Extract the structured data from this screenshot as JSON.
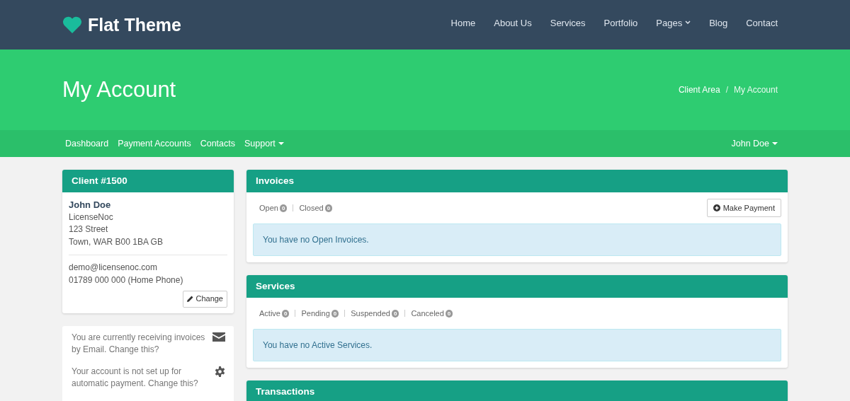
{
  "brand": {
    "name": "Flat Theme"
  },
  "nav": [
    {
      "label": "Home",
      "dropdown": false
    },
    {
      "label": "About Us",
      "dropdown": false
    },
    {
      "label": "Services",
      "dropdown": false
    },
    {
      "label": "Portfolio",
      "dropdown": false
    },
    {
      "label": "Pages",
      "dropdown": true
    },
    {
      "label": "Blog",
      "dropdown": false
    },
    {
      "label": "Contact",
      "dropdown": false
    }
  ],
  "hero": {
    "title": "My Account",
    "breadcrumb": [
      {
        "label": "Client Area",
        "current": false
      },
      {
        "label": "My Account",
        "current": true
      }
    ],
    "separator": "/"
  },
  "subnav": {
    "items": [
      {
        "label": "Dashboard",
        "dropdown": false
      },
      {
        "label": "Payment Accounts",
        "dropdown": false
      },
      {
        "label": "Contacts",
        "dropdown": false
      },
      {
        "label": "Support",
        "dropdown": true
      }
    ],
    "user": {
      "label": "John Doe",
      "dropdown": true
    }
  },
  "client": {
    "title": "Client #1500",
    "name": "John Doe",
    "address": [
      "LicenseNoc",
      "123 Street",
      "Town, WAR B00 1BA GB"
    ],
    "contact": [
      "demo@licensenoc.com",
      "01789 000 000 (Home Phone)"
    ],
    "button": "Change"
  },
  "notices": [
    {
      "text": "You are currently receiving invoices by Email. Change this?",
      "kind": "email"
    },
    {
      "text": "Your account is not set up for automatic payment. Change this?",
      "kind": "settings"
    }
  ],
  "panels": [
    {
      "title": "Invoices",
      "filters": [
        {
          "label": "Open",
          "count": "0"
        },
        {
          "label": "Closed",
          "count": "0"
        }
      ],
      "button": "Make Payment",
      "message": "You have no Open Invoices."
    },
    {
      "title": "Services",
      "filters": [
        {
          "label": "Active",
          "count": "0"
        },
        {
          "label": "Pending",
          "count": "0"
        },
        {
          "label": "Suspended",
          "count": "0"
        },
        {
          "label": "Canceled",
          "count": "0"
        }
      ],
      "message": "You have no Active Services."
    },
    {
      "title": "Transactions"
    }
  ]
}
